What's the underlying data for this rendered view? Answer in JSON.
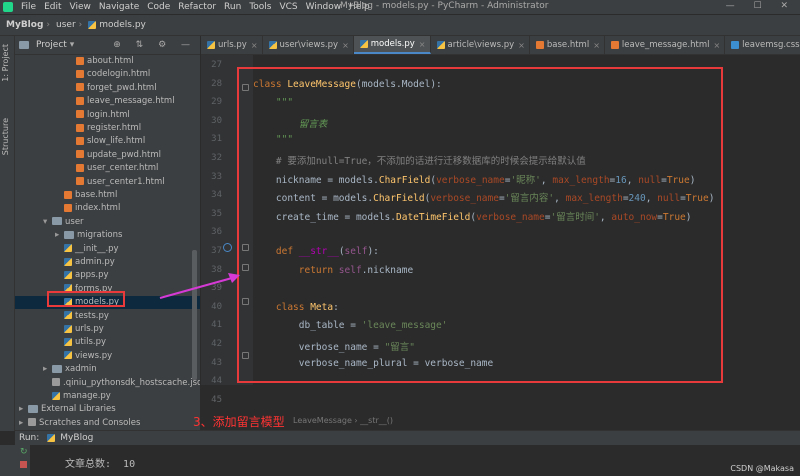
{
  "window": {
    "title": "MyBlog - models.py - PyCharm - Administrator",
    "controls": "— ☐ ✕"
  },
  "menu": [
    "File",
    "Edit",
    "View",
    "Navigate",
    "Code",
    "Refactor",
    "Run",
    "Tools",
    "VCS",
    "Window",
    "Help"
  ],
  "breadcrumb": [
    "MyBlog",
    "user",
    "models.py"
  ],
  "project_panel": {
    "title": "Project",
    "tree": [
      {
        "label": "about.html",
        "icon": "html-file-icon",
        "indent": 4
      },
      {
        "label": "codelogin.html",
        "icon": "html-file-icon",
        "indent": 4
      },
      {
        "label": "forget_pwd.html",
        "icon": "html-file-icon",
        "indent": 4
      },
      {
        "label": "leave_message.html",
        "icon": "html-file-icon",
        "indent": 4
      },
      {
        "label": "login.html",
        "icon": "html-file-icon",
        "indent": 4
      },
      {
        "label": "register.html",
        "icon": "html-file-icon",
        "indent": 4
      },
      {
        "label": "slow_life.html",
        "icon": "html-file-icon",
        "indent": 4
      },
      {
        "label": "update_pwd.html",
        "icon": "html-file-icon",
        "indent": 4
      },
      {
        "label": "user_center.html",
        "icon": "html-file-icon",
        "indent": 4
      },
      {
        "label": "user_center1.html",
        "icon": "html-file-icon",
        "indent": 4
      },
      {
        "label": "base.html",
        "icon": "html-file-icon",
        "indent": 3
      },
      {
        "label": "index.html",
        "icon": "html-file-icon",
        "indent": 3
      },
      {
        "label": "user",
        "icon": "folder-icon",
        "indent": 2,
        "arrow": "▾"
      },
      {
        "label": "migrations",
        "icon": "folder-icon",
        "indent": 3,
        "arrow": "▸"
      },
      {
        "label": "__init__.py",
        "icon": "python-file-icon",
        "indent": 3
      },
      {
        "label": "admin.py",
        "icon": "python-file-icon",
        "indent": 3
      },
      {
        "label": "apps.py",
        "icon": "python-file-icon",
        "indent": 3
      },
      {
        "label": "forms.py",
        "icon": "python-file-icon",
        "indent": 3
      },
      {
        "label": "models.py",
        "icon": "python-file-icon",
        "indent": 3,
        "selected": true
      },
      {
        "label": "tests.py",
        "icon": "python-file-icon",
        "indent": 3
      },
      {
        "label": "urls.py",
        "icon": "python-file-icon",
        "indent": 3
      },
      {
        "label": "utils.py",
        "icon": "python-file-icon",
        "indent": 3
      },
      {
        "label": "views.py",
        "icon": "python-file-icon",
        "indent": 3
      },
      {
        "label": "xadmin",
        "icon": "folder-icon",
        "indent": 2,
        "arrow": "▸"
      },
      {
        "label": ".qiniu_pythonsdk_hostscache.json",
        "icon": "json-file-icon",
        "indent": 2
      },
      {
        "label": "manage.py",
        "icon": "python-file-icon",
        "indent": 2
      },
      {
        "label": "External Libraries",
        "icon": "library-icon",
        "indent": 0,
        "arrow": "▸"
      },
      {
        "label": "Scratches and Consoles",
        "icon": "scratch-icon",
        "indent": 0,
        "arrow": "▸"
      }
    ]
  },
  "side_tabs": [
    "1: Project",
    "Structure"
  ],
  "editor_tabs": [
    {
      "label": "urls.py",
      "icon": "python-file-icon",
      "active": false
    },
    {
      "label": "user\\views.py",
      "icon": "python-file-icon",
      "active": false
    },
    {
      "label": "models.py",
      "icon": "python-file-icon",
      "active": true
    },
    {
      "label": "article\\views.py",
      "icon": "python-file-icon",
      "active": false
    },
    {
      "label": "base.html",
      "icon": "html-file-icon",
      "active": false
    },
    {
      "label": "leave_message.html",
      "icon": "html-file-icon",
      "active": false
    },
    {
      "label": "leavemsg.css",
      "icon": "css-file-icon",
      "active": false
    }
  ],
  "code": {
    "first_line": 27,
    "current_line": 37,
    "lines": [
      [],
      [
        [
          "kw",
          "class "
        ],
        [
          "cls",
          "LeaveMessage"
        ],
        [
          "p",
          "(models.Model):"
        ]
      ],
      [
        [
          "doc",
          "    \"\"\""
        ]
      ],
      [
        [
          "doc",
          "        留言表"
        ]
      ],
      [
        [
          "doc",
          "    \"\"\""
        ]
      ],
      [
        [
          "cmt",
          "    # 要添加null=True，不添加的话进行迁移数据库的时候会提示给默认值"
        ]
      ],
      [
        [
          "p",
          "    nickname = models."
        ],
        [
          "cls",
          "CharField"
        ],
        [
          "p",
          "("
        ],
        [
          "param",
          "verbose_name"
        ],
        [
          "p",
          "="
        ],
        [
          "str",
          "'昵称'"
        ],
        [
          "p",
          ", "
        ],
        [
          "param",
          "max_length"
        ],
        [
          "p",
          "="
        ],
        [
          "num",
          "16"
        ],
        [
          "p",
          ", "
        ],
        [
          "param",
          "null"
        ],
        [
          "p",
          "="
        ],
        [
          "kw",
          "True"
        ],
        [
          "p",
          ")"
        ]
      ],
      [
        [
          "p",
          "    content = models."
        ],
        [
          "cls",
          "CharField"
        ],
        [
          "p",
          "("
        ],
        [
          "param",
          "verbose_name"
        ],
        [
          "p",
          "="
        ],
        [
          "str",
          "'留言内容'"
        ],
        [
          "p",
          ", "
        ],
        [
          "param",
          "max_length"
        ],
        [
          "p",
          "="
        ],
        [
          "num",
          "240"
        ],
        [
          "p",
          ", "
        ],
        [
          "param",
          "null"
        ],
        [
          "p",
          "="
        ],
        [
          "kw",
          "True"
        ],
        [
          "p",
          ")"
        ]
      ],
      [
        [
          "p",
          "    create_time = models."
        ],
        [
          "cls",
          "DateTimeField"
        ],
        [
          "p",
          "("
        ],
        [
          "param",
          "verbose_name"
        ],
        [
          "p",
          "="
        ],
        [
          "str",
          "'留言时间'"
        ],
        [
          "p",
          ", "
        ],
        [
          "param",
          "auto_now"
        ],
        [
          "p",
          "="
        ],
        [
          "kw",
          "True"
        ],
        [
          "p",
          ")"
        ]
      ],
      [],
      [
        [
          "kw",
          "    def "
        ],
        [
          "magic",
          "__str__"
        ],
        [
          "p",
          "("
        ],
        [
          "selfk",
          "self"
        ],
        [
          "p",
          "):"
        ]
      ],
      [
        [
          "kw",
          "        return "
        ],
        [
          "selfk",
          "self"
        ],
        [
          "p",
          ".nickname"
        ]
      ],
      [],
      [
        [
          "kw",
          "    class "
        ],
        [
          "cls",
          "Meta"
        ],
        [
          "p",
          ":"
        ]
      ],
      [
        [
          "p",
          "        db_table = "
        ],
        [
          "str",
          "'leave_message'"
        ]
      ],
      [
        [
          "p",
          "        verbose_name = "
        ],
        [
          "str",
          "\"留言\""
        ]
      ],
      [
        [
          "p",
          "        verbose_name_plural = verbose_name"
        ]
      ],
      [],
      []
    ]
  },
  "editor_breadcrumb": "LeaveMessage  ›  __str__()",
  "annotation": "3、添加留言模型",
  "run_panel": {
    "label": "Run:",
    "config": "MyBlog",
    "output": "文章总数:  10"
  },
  "watermark": "CSDN @Makasa"
}
